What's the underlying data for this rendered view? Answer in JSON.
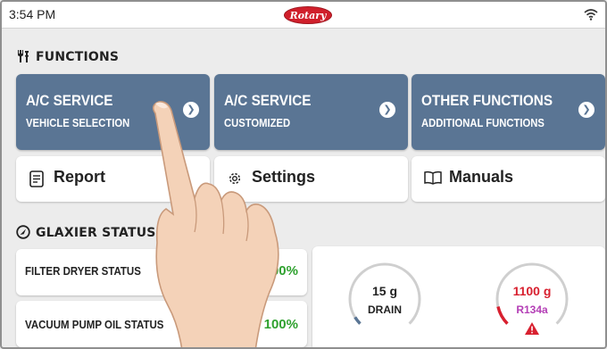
{
  "status_bar": {
    "time": "3:54 PM",
    "logo_text": "Rotary",
    "wifi_icon": "wifi-icon"
  },
  "functions": {
    "title": "FUNCTIONS",
    "buttons": [
      {
        "title": "A/C SERVICE",
        "subtitle": "VEHICLE SELECTION"
      },
      {
        "title": "A/C SERVICE",
        "subtitle": "CUSTOMIZED"
      },
      {
        "title": "OTHER FUNCTIONS",
        "subtitle": "ADDITIONAL FUNCTIONS"
      }
    ],
    "options": [
      {
        "label": "Report",
        "icon": "report-icon"
      },
      {
        "label": "Settings",
        "icon": "gear-icon"
      },
      {
        "label": "Manuals",
        "icon": "book-icon"
      }
    ]
  },
  "status": {
    "title": "GLAXIER STATUS",
    "items": [
      {
        "label": "FILTER DRYER STATUS",
        "value": "100%"
      },
      {
        "label": "VACUUM PUMP OIL STATUS",
        "value": "100%"
      }
    ],
    "gauges": [
      {
        "value": "15 g",
        "label": "DRAIN",
        "level": 0.05,
        "color": "#5a7594"
      },
      {
        "value": "1100 g",
        "label": "R134a",
        "level": 0.12,
        "color": "#d8202f",
        "warning": true
      }
    ]
  },
  "colors": {
    "button_blue": "#5a7594",
    "ok_green": "#2fa12f",
    "alert_red": "#d8202f",
    "refrigerant_purple": "#b43fb6"
  }
}
